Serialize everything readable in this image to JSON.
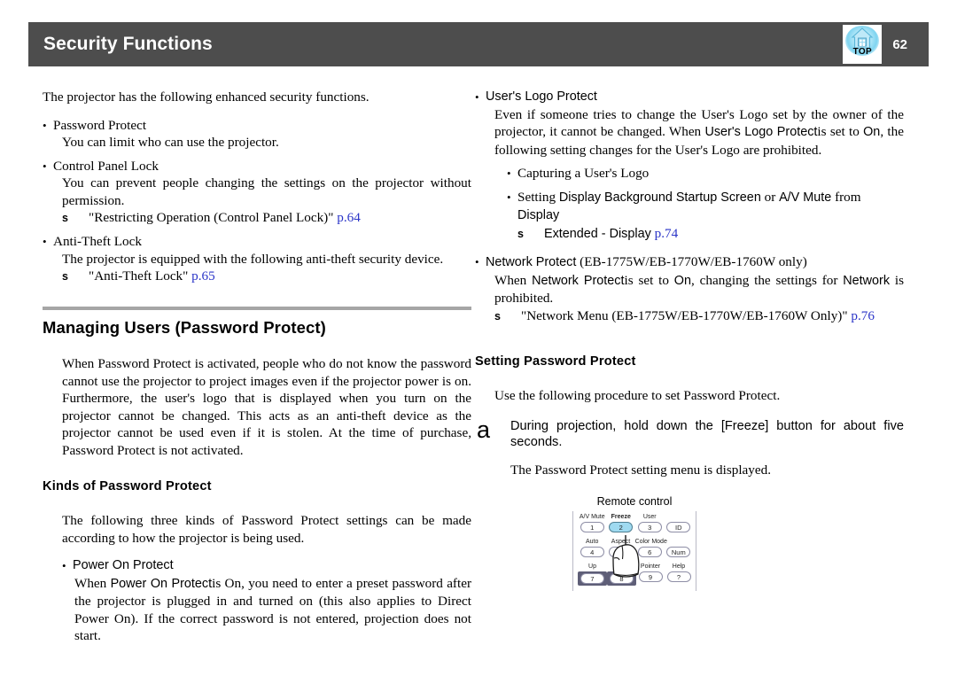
{
  "header": {
    "title": "Security Functions",
    "page_number": "62",
    "top_icon_label": "TOP"
  },
  "left_column": {
    "intro": "The projector has the following enhanced security functions.",
    "features": [
      {
        "bullet": "•",
        "title": "Password Protect",
        "description": "You can limit who can use the projector.",
        "reference": null
      },
      {
        "bullet": "•",
        "title": "Control Panel Lock",
        "description": "You can prevent people changing the settings on the projector without permission.",
        "reference": {
          "arrow": "s",
          "text": "\"Restricting Operation (Control Panel Lock)\"",
          "link": "p.64"
        }
      },
      {
        "bullet": "•",
        "title": "Anti-Theft Lock",
        "description": "The projector is equipped with the following anti-theft security device.",
        "reference": {
          "arrow": "s",
          "text": "\"Anti-Theft Lock\"",
          "link": "p.65"
        }
      }
    ],
    "section_heading": "Managing Users (Password Protect)",
    "section_paragraph": "When Password Protect is activated, people who do not know the password cannot use the projector to project images even if the projector power is on. Furthermore, the user's logo that is displayed when you turn on the projector cannot be changed. This acts as an anti-theft device as the projector cannot be used even if it is stolen. At the time of purchase, Password Protect is not activated.",
    "subsection_heading": "Kinds of Password Protect",
    "subsection_paragraph": "The following three kinds of Password Protect settings can be made according to how the projector is being used.",
    "power_on_protect": {
      "bullet": "•",
      "title": "Power On Protect",
      "body_part_1": "When ",
      "ui_term_1": "Power On Protect",
      "body_part_2": "is On, you need to enter a preset password after the projector is plugged in and turned on (this also applies to Direct Power On). If the correct password is not entered, projection does not start."
    }
  },
  "right_column": {
    "users_logo_protect": {
      "bullet": "•",
      "title": "User's Logo Protect",
      "body_part_1": "Even if someone tries to change the User's Logo set by the owner of the projector, it cannot be changed. When ",
      "ui_term_1": "User's Logo Protect",
      "body_part_2": "is set to ",
      "ui_term_2": "On",
      "body_part_3": ", the following setting changes for the User's Logo are prohibited.",
      "sub_items": [
        {
          "bullet": "•",
          "text": "Capturing a User's Logo"
        },
        {
          "bullet": "•",
          "prefix": "Setting ",
          "ui_term": "Display Background Startup Screen",
          "middle": " or ",
          "ui_term_2": "A/V Mute",
          "suffix": " from ",
          "ui_term_3": "Display",
          "reference": {
            "arrow": "s",
            "text": "Extended - Display",
            "link": "p.74"
          }
        }
      ]
    },
    "network_protect": {
      "bullet": "•",
      "title": "Network Protect",
      "title_suffix": " (EB-1775W/EB-1770W/EB-1760W only)",
      "body_part_1": "When ",
      "ui_term_1": "Network Protect",
      "body_part_2": "is set to ",
      "ui_term_2": "On",
      "body_part_3": ", changing the settings for ",
      "ui_term_3": "Network",
      "body_part_4": " is prohibited.",
      "reference": {
        "arrow": "s",
        "text": "\"Network Menu (EB-1775W/EB-1770W/EB-1760W Only)\"",
        "link": "p.76"
      }
    },
    "setting_heading": "Setting Password Protect",
    "setting_paragraph": "Use the following procedure to set Password Protect.",
    "step": {
      "marker": "a",
      "text": "During projection, hold down the [Freeze] button for about five seconds.",
      "result": "The Password Protect setting menu is displayed."
    },
    "figure": {
      "caption": "Remote control",
      "rows": [
        {
          "cells": [
            {
              "label": "A/V Mute",
              "key": "1",
              "highlight": false,
              "dark": false,
              "bold": false
            },
            {
              "label": "Freeze",
              "key": "2",
              "highlight": true,
              "dark": false,
              "bold": true
            },
            {
              "label": "User",
              "key": "3",
              "highlight": false,
              "dark": false,
              "bold": false
            },
            {
              "label": "",
              "key": "ID",
              "highlight": false,
              "dark": false,
              "bold": false
            }
          ]
        },
        {
          "cells": [
            {
              "label": "Auto",
              "key": "4",
              "highlight": false,
              "dark": false,
              "bold": false
            },
            {
              "label": "Aspect",
              "key": "5",
              "highlight": false,
              "dark": false,
              "bold": false
            },
            {
              "label": "Color Mode",
              "key": "6",
              "highlight": false,
              "dark": false,
              "bold": false
            },
            {
              "label": "",
              "key": "Num",
              "highlight": false,
              "dark": false,
              "bold": false
            }
          ]
        },
        {
          "cells": [
            {
              "label": "Up",
              "key": "7",
              "highlight": false,
              "dark": true,
              "bold": false
            },
            {
              "label": "",
              "key": "8",
              "highlight": false,
              "dark": true,
              "bold": false
            },
            {
              "label": "Pointer",
              "key": "9",
              "highlight": false,
              "dark": false,
              "bold": false
            },
            {
              "label": "Help",
              "key": "?",
              "highlight": false,
              "dark": false,
              "bold": false
            }
          ]
        }
      ]
    }
  },
  "colors": {
    "header_bar": "#4d4d4d",
    "rule": "#a6a6a6",
    "link": "#2b35c8",
    "key_highlight": "#9fdaf0",
    "key_dark": "#5e5e77"
  }
}
